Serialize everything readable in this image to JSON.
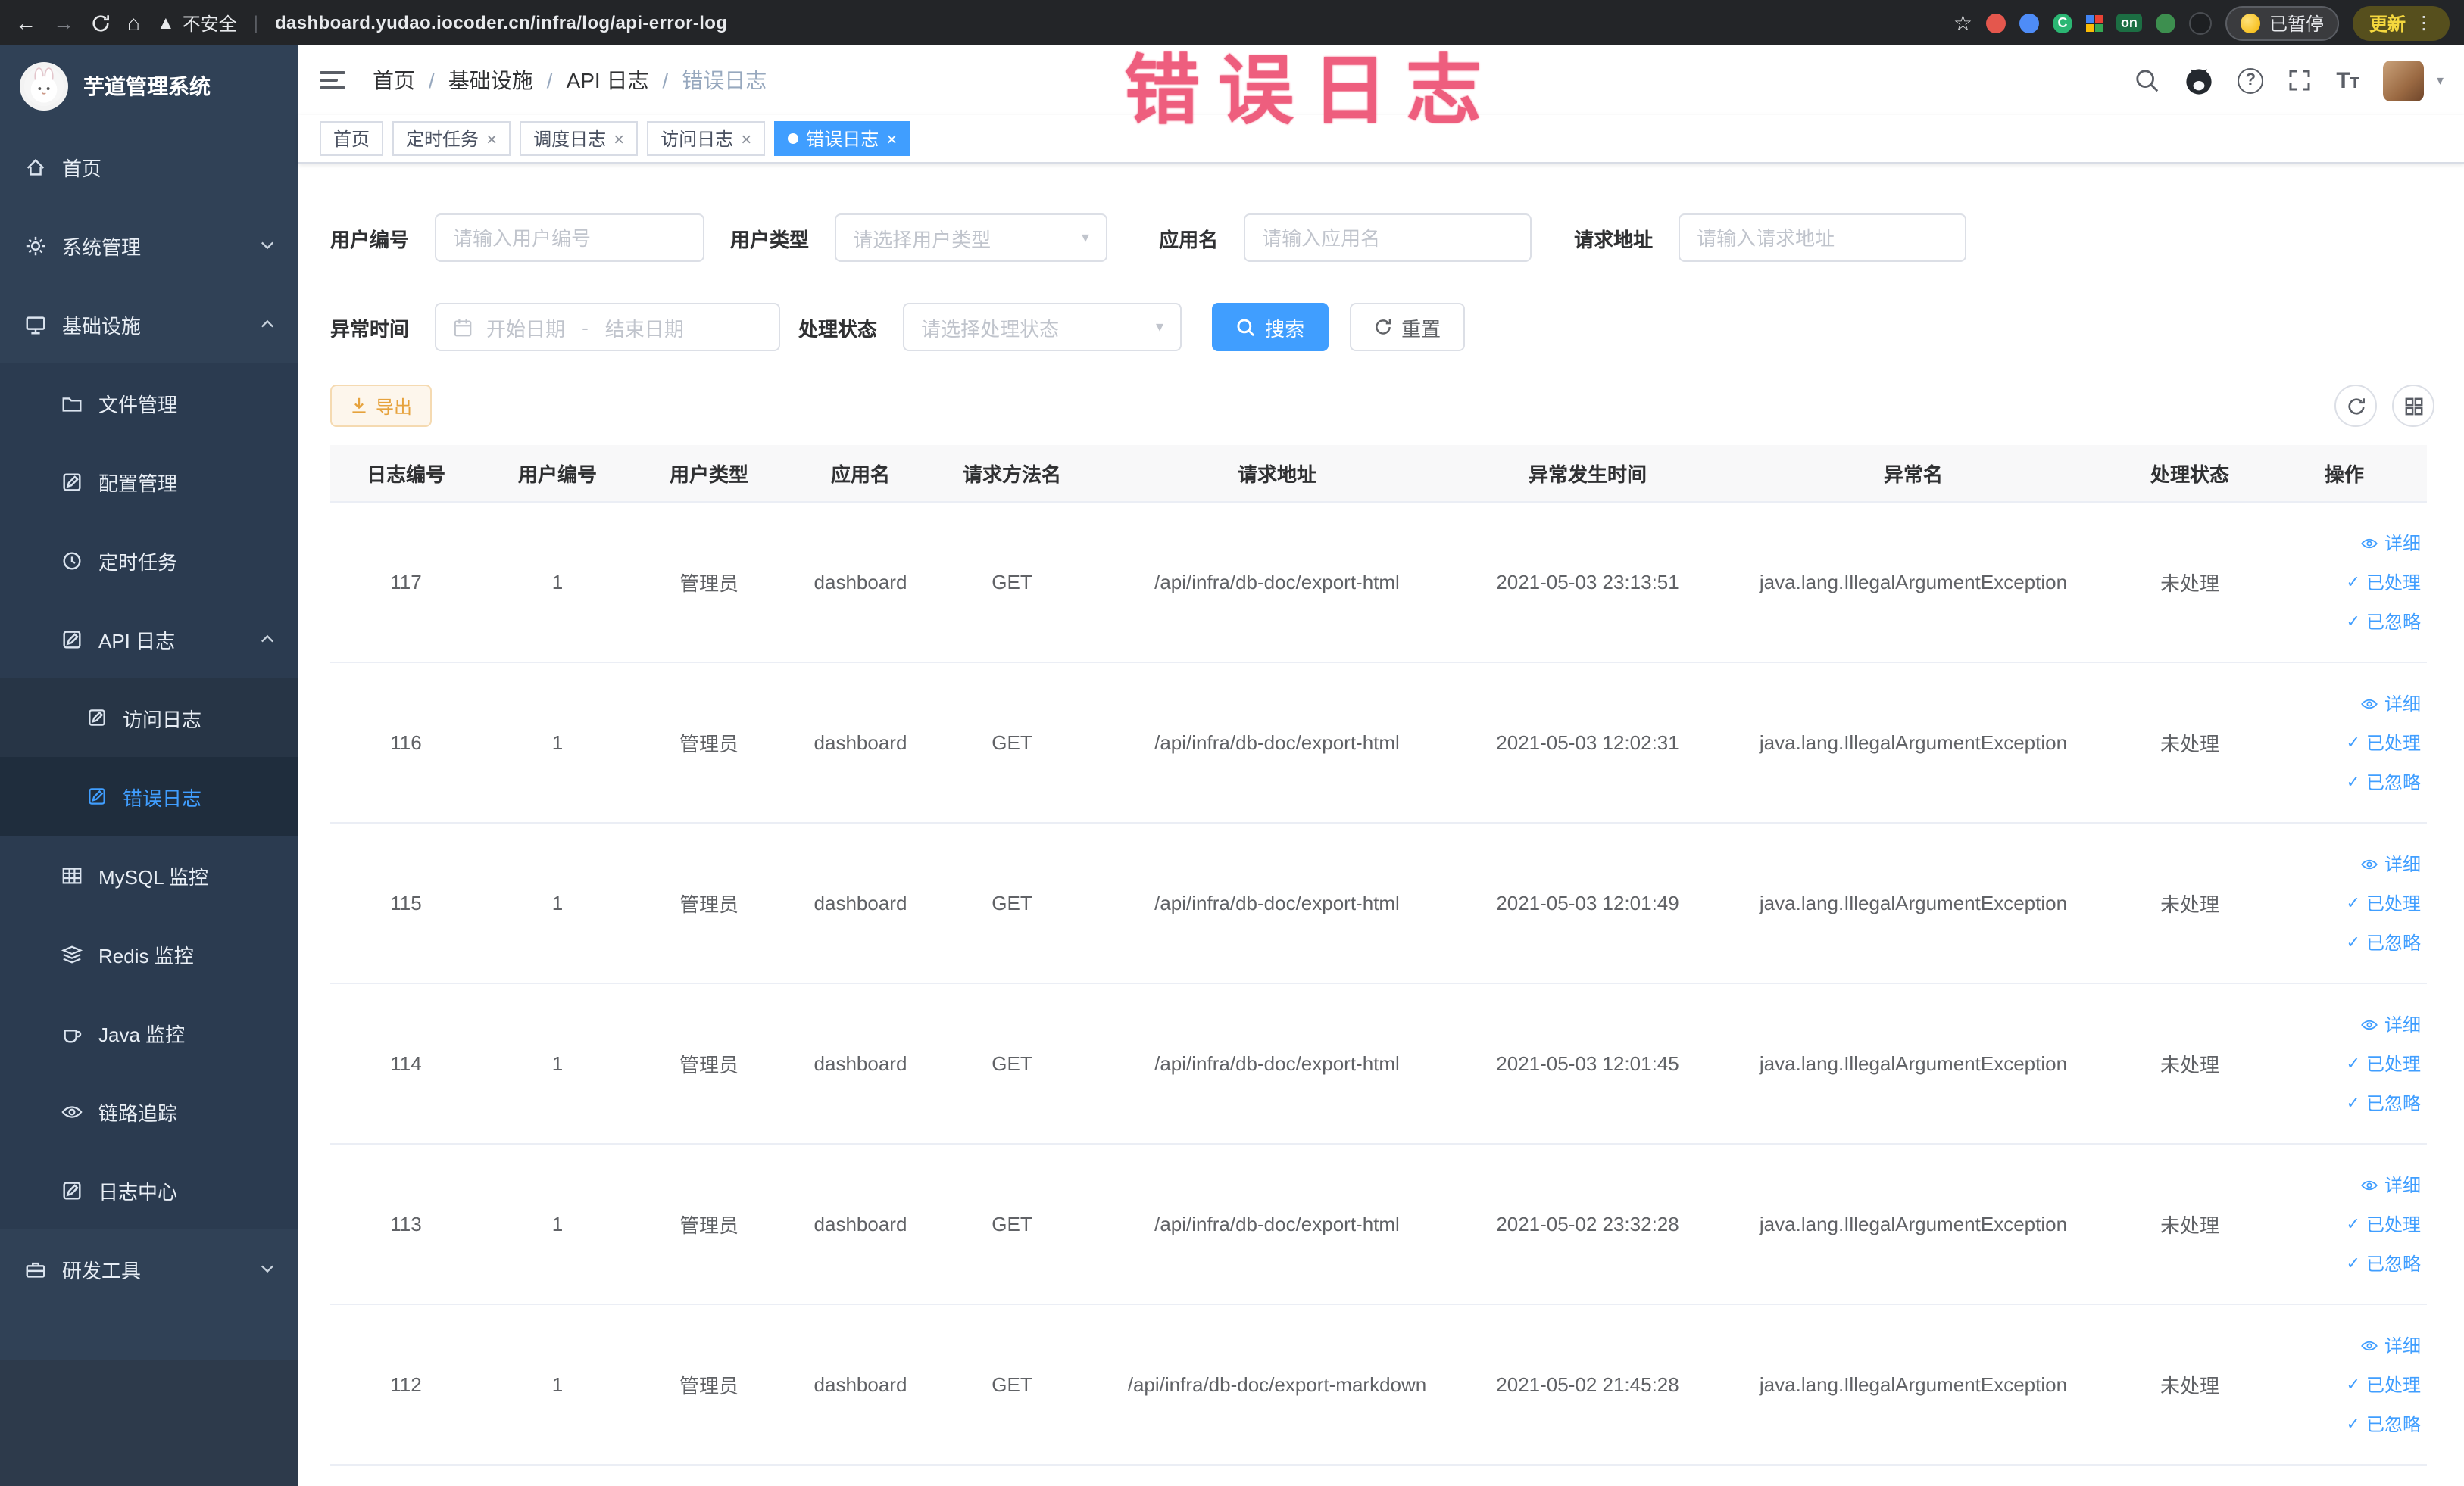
{
  "browser": {
    "security_warning": "不安全",
    "url": "dashboard.yudao.iocoder.cn/infra/log/api-error-log",
    "extension_on_badge": "on",
    "paused_badge": "已暂停",
    "update_button": "更新"
  },
  "annotation": {
    "text": "错误日志"
  },
  "sidebar": {
    "logo_title": "芋道管理系统",
    "items": [
      {
        "label": "首页"
      },
      {
        "label": "系统管理"
      },
      {
        "label": "基础设施"
      },
      {
        "label": "文件管理"
      },
      {
        "label": "配置管理"
      },
      {
        "label": "定时任务"
      },
      {
        "label": "API 日志"
      },
      {
        "label": "访问日志"
      },
      {
        "label": "错误日志"
      },
      {
        "label": "MySQL 监控"
      },
      {
        "label": "Redis 监控"
      },
      {
        "label": "Java 监控"
      },
      {
        "label": "链路追踪"
      },
      {
        "label": "日志中心"
      },
      {
        "label": "研发工具"
      }
    ]
  },
  "header": {
    "breadcrumb": [
      {
        "label": "首页"
      },
      {
        "label": "基础设施"
      },
      {
        "label": "API 日志"
      },
      {
        "label": "错误日志"
      }
    ],
    "breadcrumb_separator": "/"
  },
  "tabs": [
    {
      "label": "首页"
    },
    {
      "label": "定时任务"
    },
    {
      "label": "调度日志"
    },
    {
      "label": "访问日志"
    },
    {
      "label": "错误日志"
    }
  ],
  "filters": {
    "user_id_label": "用户编号",
    "user_id_placeholder": "请输入用户编号",
    "user_type_label": "用户类型",
    "user_type_placeholder": "请选择用户类型",
    "app_name_label": "应用名",
    "app_name_placeholder": "请输入应用名",
    "request_url_label": "请求地址",
    "request_url_placeholder": "请输入请求地址",
    "exception_time_label": "异常时间",
    "date_start_placeholder": "开始日期",
    "date_separator": "-",
    "date_end_placeholder": "结束日期",
    "process_status_label": "处理状态",
    "process_status_placeholder": "请选择处理状态",
    "search_button": "搜索",
    "reset_button": "重置"
  },
  "toolbar": {
    "export_button": "导出"
  },
  "table": {
    "columns": [
      "日志编号",
      "用户编号",
      "用户类型",
      "应用名",
      "请求方法名",
      "请求地址",
      "异常发生时间",
      "异常名",
      "处理状态",
      "操作"
    ],
    "op": {
      "detail": "详细",
      "processed": "已处理",
      "ignored": "已忽略"
    },
    "rows": [
      {
        "id": "117",
        "user_id": "1",
        "user_type": "管理员",
        "app": "dashboard",
        "method": "GET",
        "url": "/api/infra/db-doc/export-html",
        "time": "2021-05-03 23:13:51",
        "exception": "java.lang.IllegalArgumentException",
        "status": "未处理"
      },
      {
        "id": "116",
        "user_id": "1",
        "user_type": "管理员",
        "app": "dashboard",
        "method": "GET",
        "url": "/api/infra/db-doc/export-html",
        "time": "2021-05-03 12:02:31",
        "exception": "java.lang.IllegalArgumentException",
        "status": "未处理"
      },
      {
        "id": "115",
        "user_id": "1",
        "user_type": "管理员",
        "app": "dashboard",
        "method": "GET",
        "url": "/api/infra/db-doc/export-html",
        "time": "2021-05-03 12:01:49",
        "exception": "java.lang.IllegalArgumentException",
        "status": "未处理"
      },
      {
        "id": "114",
        "user_id": "1",
        "user_type": "管理员",
        "app": "dashboard",
        "method": "GET",
        "url": "/api/infra/db-doc/export-html",
        "time": "2021-05-03 12:01:45",
        "exception": "java.lang.IllegalArgumentException",
        "status": "未处理"
      },
      {
        "id": "113",
        "user_id": "1",
        "user_type": "管理员",
        "app": "dashboard",
        "method": "GET",
        "url": "/api/infra/db-doc/export-html",
        "time": "2021-05-02 23:32:28",
        "exception": "java.lang.IllegalArgumentException",
        "status": "未处理"
      },
      {
        "id": "112",
        "user_id": "1",
        "user_type": "管理员",
        "app": "dashboard",
        "method": "GET",
        "url": "/api/infra/db-doc/export-markdown",
        "time": "2021-05-02 21:45:28",
        "exception": "java.lang.IllegalArgumentException",
        "status": "未处理"
      }
    ]
  },
  "colors": {
    "accent": "#409eff",
    "warning": "#e6a23c",
    "sidebar_bg": "#304156",
    "annotation": "#ee5576",
    "tab_active_bg": "#409eff"
  }
}
